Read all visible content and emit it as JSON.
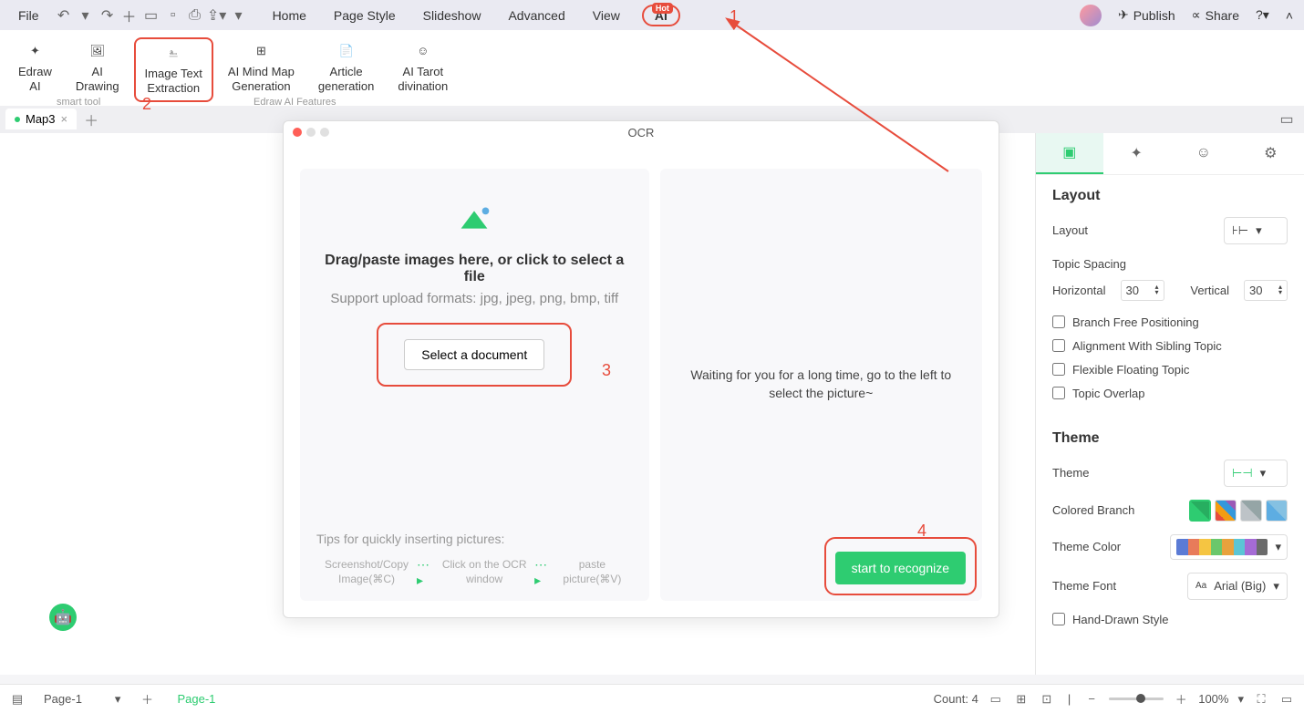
{
  "menu": {
    "file": "File",
    "tabs": [
      "Home",
      "Page Style",
      "Slideshow",
      "Advanced",
      "View"
    ],
    "ai": "AI",
    "hot": "Hot",
    "publish": "Publish",
    "share": "Share"
  },
  "ribbon": {
    "items": [
      {
        "label": "Edraw\nAI"
      },
      {
        "label": "AI\nDrawing"
      },
      {
        "label": "Image Text\nExtraction"
      },
      {
        "label": "AI Mind Map\nGeneration"
      },
      {
        "label": "Article\ngeneration"
      },
      {
        "label": "AI Tarot\ndivination"
      }
    ],
    "group1": "smart tool",
    "group2": "Edraw AI Features"
  },
  "docTab": "Map3",
  "modal": {
    "title": "OCR",
    "heading": "Drag/paste images here, or click to select a file",
    "sub": "Support upload formats: jpg, jpeg, png, bmp, tiff",
    "selectBtn": "Select a document",
    "tipsHeading": "Tips for quickly inserting pictures:",
    "tip1": "Screenshot/Copy Image(⌘C)",
    "tip2": "Click on the OCR window",
    "tip3": "paste picture(⌘V)",
    "waitText": "Waiting for you for a long time, go to the left to select the picture~",
    "recognize": "start to recognize"
  },
  "annotations": {
    "n1": "1",
    "n2": "2",
    "n3": "3",
    "n4": "4"
  },
  "panel": {
    "layout": "Layout",
    "layoutLabel": "Layout",
    "topicSpacing": "Topic Spacing",
    "horizontal": "Horizontal",
    "hVal": "30",
    "vertical": "Vertical",
    "vVal": "30",
    "cb1": "Branch Free Positioning",
    "cb2": "Alignment With Sibling Topic",
    "cb3": "Flexible Floating Topic",
    "cb4": "Topic Overlap",
    "theme": "Theme",
    "themeLabel": "Theme",
    "coloredBranch": "Colored Branch",
    "themeColor": "Theme Color",
    "themeFont": "Theme Font",
    "fontVal": "Arial (Big)",
    "cb5": "Hand-Drawn Style"
  },
  "status": {
    "pageDd": "Page-1",
    "pageTab": "Page-1",
    "count": "Count: 4",
    "zoom": "100%"
  }
}
